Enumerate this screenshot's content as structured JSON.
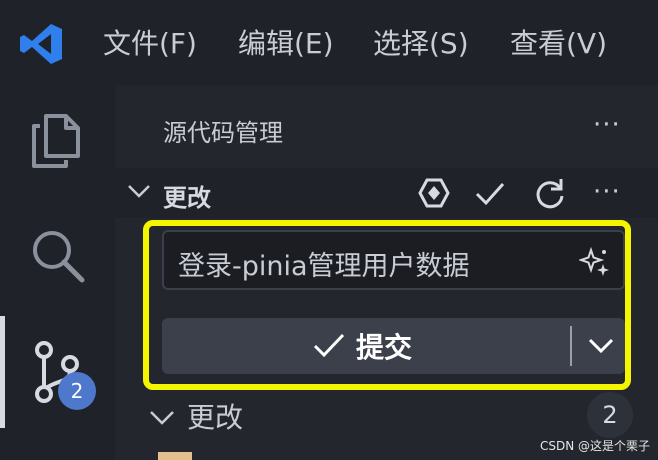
{
  "menubar": {
    "items": [
      "文件(F)",
      "编辑(E)",
      "选择(S)",
      "查看(V)"
    ]
  },
  "sidebar": {
    "title": "源代码管理",
    "section_title": "更改",
    "commit_message": "登录-pinia管理用户数据",
    "commit_button_label": "提交",
    "changes_title": "更改",
    "changes_count": "2"
  },
  "activitybar": {
    "scm_badge": "2",
    "icons": [
      "explorer-icon",
      "search-icon",
      "source-control-icon"
    ]
  },
  "watermark": "CSDN @这是个栗子",
  "colors": {
    "accent": "#4d78cc",
    "highlight": "#f5f500",
    "vscode_blue": "#2f80ed"
  }
}
